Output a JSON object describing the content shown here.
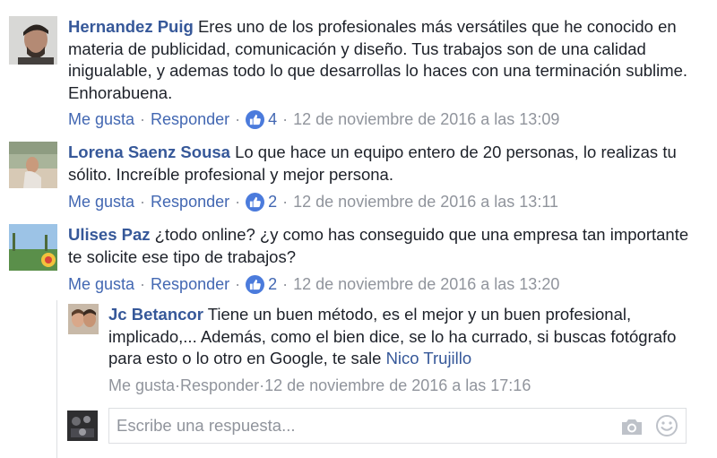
{
  "comments": [
    {
      "author": "Hernandez Puig",
      "text": "Eres uno de los profesionales más versátiles que he conocido en materia de publicidad, comunicación y diseño. Tus trabajos son de una calidad inigualable, y ademas todo lo que desarrollas lo haces con una terminación sublime. Enhorabuena.",
      "like_label": "Me gusta",
      "reply_label": "Responder",
      "like_count": "4",
      "timestamp": "12 de noviembre de 2016 a las 13:09"
    },
    {
      "author": "Lorena Saenz Sousa",
      "text": "Lo que hace un equipo entero de 20 personas, lo realizas tu sólito. Increíble profesional y mejor persona.",
      "like_label": "Me gusta",
      "reply_label": "Responder",
      "like_count": "2",
      "timestamp": "12 de noviembre de 2016 a las 13:11"
    },
    {
      "author": "Ulises Paz",
      "text": "¿todo online? ¿y como has conseguido que una empresa tan importante te solicite ese tipo de trabajos?",
      "like_label": "Me gusta",
      "reply_label": "Responder",
      "like_count": "2",
      "timestamp": "12 de noviembre de 2016 a las 13:20"
    }
  ],
  "reply": {
    "author": "Jc Betancor",
    "text": "Tiene un buen método, es el mejor y un buen profesional, implicado,... Además, como el bien dice, se lo ha currado, si buscas fotógrafo para esto o lo otro en Google, te sale",
    "mention": "Nico Trujillo",
    "like_label": "Me gusta",
    "reply_label": "Responder",
    "timestamp": "12 de noviembre de 2016 a las 17:16"
  },
  "composer": {
    "placeholder": "Escribe una respuesta...",
    "camera_icon": "camera-icon",
    "emoji_icon": "smiley-icon"
  },
  "separator": "·",
  "colors": {
    "author": "#365899",
    "link": "#4267b2",
    "meta": "#90949c",
    "like_badge": "#4b7bdc"
  }
}
